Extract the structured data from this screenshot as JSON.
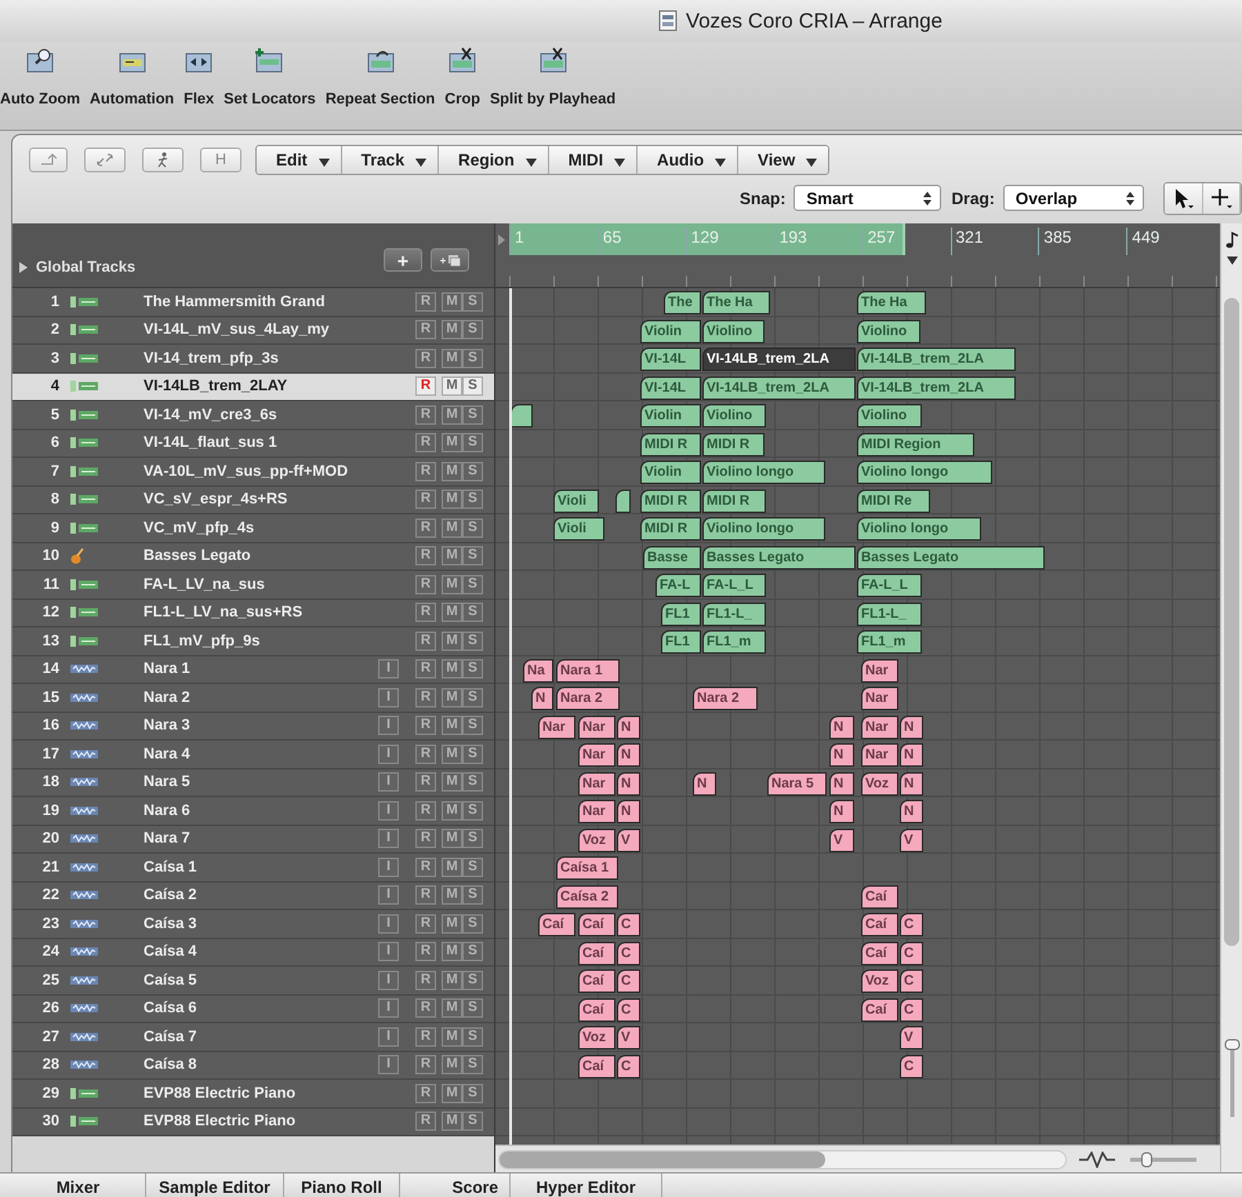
{
  "window": {
    "title": "Vozes Coro CRIA – Arrange"
  },
  "toolbar": [
    {
      "label": "Auto Zoom"
    },
    {
      "label": "Automation"
    },
    {
      "label": "Flex"
    },
    {
      "label": "Set Locators"
    },
    {
      "label": "Repeat Section"
    },
    {
      "label": "Crop"
    },
    {
      "label": "Split by Playhead"
    }
  ],
  "local_buttons": {
    "h": "H"
  },
  "menus": [
    "Edit",
    "Track",
    "Region",
    "MIDI",
    "Audio",
    "View"
  ],
  "snap": {
    "label": "Snap:",
    "value": "Smart"
  },
  "drag": {
    "label": "Drag:",
    "value": "Overlap"
  },
  "global_tracks": {
    "label": "Global Tracks",
    "expanded": false,
    "add": "+"
  },
  "ruler": {
    "marks": [
      "1",
      "65",
      "129",
      "193",
      "257",
      "321",
      "385",
      "449"
    ]
  },
  "tracks": [
    {
      "number": "1",
      "name": "The Hammersmith Grand",
      "kind": "software",
      "selected": false,
      "record": false,
      "buttons": [
        "R",
        "M",
        "S"
      ],
      "regions": [
        {
          "label": "The",
          "selected": false
        },
        {
          "label": "The Ha",
          "selected": false
        },
        {
          "label": "The Ha",
          "selected": false
        }
      ]
    },
    {
      "number": "2",
      "name": "VI-14L_mV_sus_4Lay_my",
      "kind": "software",
      "selected": false,
      "record": false,
      "buttons": [
        "R",
        "M",
        "S"
      ],
      "regions": [
        {
          "label": "Violin",
          "selected": false
        },
        {
          "label": "Violino",
          "selected": false
        },
        {
          "label": "Violino",
          "selected": false
        }
      ]
    },
    {
      "number": "3",
      "name": "VI-14_trem_pfp_3s",
      "kind": "software",
      "selected": false,
      "record": false,
      "buttons": [
        "R",
        "M",
        "S"
      ],
      "regions": [
        {
          "label": "VI-14L",
          "selected": false
        },
        {
          "label": "VI-14LB_trem_2LA",
          "selected": true
        },
        {
          "label": "VI-14LB_trem_2LA",
          "selected": false
        }
      ]
    },
    {
      "number": "4",
      "name": "VI-14LB_trem_2LAY",
      "kind": "software",
      "selected": true,
      "record": true,
      "buttons": [
        "R",
        "M",
        "S"
      ],
      "regions": [
        {
          "label": "VI-14L",
          "selected": false
        },
        {
          "label": "VI-14LB_trem_2LA",
          "selected": false
        },
        {
          "label": "VI-14LB_trem_2LA",
          "selected": false
        }
      ]
    },
    {
      "number": "5",
      "name": "VI-14_mV_cre3_6s",
      "kind": "software",
      "selected": false,
      "record": false,
      "buttons": [
        "R",
        "M",
        "S"
      ],
      "regions": [
        {
          "selected": false
        },
        {
          "label": "Violin",
          "selected": false
        },
        {
          "label": "Violino",
          "selected": false
        },
        {
          "label": "Violino",
          "selected": false
        }
      ]
    },
    {
      "number": "6",
      "name": "VI-14L_flaut_sus 1",
      "kind": "software",
      "selected": false,
      "record": false,
      "buttons": [
        "R",
        "M",
        "S"
      ],
      "regions": [
        {
          "label": "MIDI R",
          "selected": false
        },
        {
          "label": "MIDI R",
          "selected": false
        },
        {
          "label": "MIDI Region",
          "selected": false
        }
      ]
    },
    {
      "number": "7",
      "name": "VA-10L_mV_sus_pp-ff+MOD",
      "kind": "software",
      "selected": false,
      "record": false,
      "buttons": [
        "R",
        "M",
        "S"
      ],
      "regions": [
        {
          "label": "Violin",
          "selected": false
        },
        {
          "label": "Violino longo",
          "selected": false
        },
        {
          "label": "Violino longo",
          "selected": false
        }
      ]
    },
    {
      "number": "8",
      "name": "VC_sV_espr_4s+RS",
      "kind": "software",
      "selected": false,
      "record": false,
      "buttons": [
        "R",
        "M",
        "S"
      ],
      "regions": [
        {
          "label": "Violi",
          "selected": false
        },
        {
          "selected": false
        },
        {
          "label": "MIDI R",
          "selected": false
        },
        {
          "label": "MIDI R",
          "selected": false
        },
        {
          "label": "MIDI Re",
          "selected": false
        }
      ]
    },
    {
      "number": "9",
      "name": "VC_mV_pfp_4s",
      "kind": "software",
      "selected": false,
      "record": false,
      "buttons": [
        "R",
        "M",
        "S"
      ],
      "regions": [
        {
          "label": "Violi",
          "selected": false
        },
        {
          "label": "MIDI R",
          "selected": false
        },
        {
          "label": "Violino longo",
          "selected": false
        },
        {
          "label": "Violino longo",
          "selected": false
        }
      ]
    },
    {
      "number": "10",
      "name": "Basses Legato",
      "kind": "sampler",
      "selected": false,
      "record": false,
      "buttons": [
        "R",
        "M",
        "S"
      ],
      "regions": [
        {
          "label": "Basse",
          "selected": false
        },
        {
          "label": "Basses Legato",
          "selected": false
        },
        {
          "label": "Basses Legato",
          "selected": false
        }
      ]
    },
    {
      "number": "11",
      "name": "FA-L_LV_na_sus",
      "kind": "software",
      "selected": false,
      "record": false,
      "buttons": [
        "R",
        "M",
        "S"
      ],
      "regions": [
        {
          "label": "FA-L",
          "selected": false
        },
        {
          "label": "FA-L_L",
          "selected": false
        },
        {
          "label": "FA-L_L",
          "selected": false
        }
      ]
    },
    {
      "number": "12",
      "name": "FL1-L_LV_na_sus+RS",
      "kind": "software",
      "selected": false,
      "record": false,
      "buttons": [
        "R",
        "M",
        "S"
      ],
      "regions": [
        {
          "label": "FL1",
          "selected": false
        },
        {
          "label": "FL1-L_",
          "selected": false
        },
        {
          "label": "FL1-L_",
          "selected": false
        }
      ]
    },
    {
      "number": "13",
      "name": "FL1_mV_pfp_9s",
      "kind": "software",
      "selected": false,
      "record": false,
      "buttons": [
        "R",
        "M",
        "S"
      ],
      "regions": [
        {
          "label": "FL1",
          "selected": false
        },
        {
          "label": "FL1_m",
          "selected": false
        },
        {
          "label": "FL1_m",
          "selected": false
        }
      ]
    },
    {
      "number": "14",
      "name": "Nara 1",
      "kind": "audio",
      "selected": false,
      "record": false,
      "buttons": [
        "I",
        "R",
        "M",
        "S"
      ],
      "regions": [
        {
          "label": "Na",
          "selected": false
        },
        {
          "label": "Nara 1",
          "selected": false
        },
        {
          "label": "Nar",
          "selected": false
        }
      ]
    },
    {
      "number": "15",
      "name": "Nara 2",
      "kind": "audio",
      "selected": false,
      "record": false,
      "buttons": [
        "I",
        "R",
        "M",
        "S"
      ],
      "regions": [
        {
          "label": "N",
          "selected": false
        },
        {
          "label": "Nara 2",
          "selected": false
        },
        {
          "label": "Nara 2",
          "selected": false
        },
        {
          "label": "Nar",
          "selected": false
        }
      ]
    },
    {
      "number": "16",
      "name": "Nara 3",
      "kind": "audio",
      "selected": false,
      "record": false,
      "buttons": [
        "I",
        "R",
        "M",
        "S"
      ],
      "regions": [
        {
          "label": "Nar",
          "selected": false
        },
        {
          "label": "Nar",
          "selected": false
        },
        {
          "label": "N",
          "selected": false
        },
        {
          "label": "N",
          "selected": false
        },
        {
          "label": "Nar",
          "selected": false
        },
        {
          "label": "N",
          "selected": false
        }
      ]
    },
    {
      "number": "17",
      "name": "Nara 4",
      "kind": "audio",
      "selected": false,
      "record": false,
      "buttons": [
        "I",
        "R",
        "M",
        "S"
      ],
      "regions": [
        {
          "label": "Nar",
          "selected": false
        },
        {
          "label": "N",
          "selected": false
        },
        {
          "label": "N",
          "selected": false
        },
        {
          "label": "Nar",
          "selected": false
        },
        {
          "label": "N",
          "selected": false
        }
      ]
    },
    {
      "number": "18",
      "name": "Nara 5",
      "kind": "audio",
      "selected": false,
      "record": false,
      "buttons": [
        "I",
        "R",
        "M",
        "S"
      ],
      "regions": [
        {
          "label": "Nar",
          "selected": false
        },
        {
          "label": "N",
          "selected": false
        },
        {
          "label": "N",
          "selected": false
        },
        {
          "label": "Nara 5",
          "selected": false
        },
        {
          "label": "N",
          "selected": false
        },
        {
          "label": "Voz",
          "selected": false
        },
        {
          "label": "N",
          "selected": false
        }
      ]
    },
    {
      "number": "19",
      "name": "Nara 6",
      "kind": "audio",
      "selected": false,
      "record": false,
      "buttons": [
        "I",
        "R",
        "M",
        "S"
      ],
      "regions": [
        {
          "label": "Nar",
          "selected": false
        },
        {
          "label": "N",
          "selected": false
        },
        {
          "label": "N",
          "selected": false
        },
        {
          "label": "N",
          "selected": false
        }
      ]
    },
    {
      "number": "20",
      "name": "Nara 7",
      "kind": "audio",
      "selected": false,
      "record": false,
      "buttons": [
        "I",
        "R",
        "M",
        "S"
      ],
      "regions": [
        {
          "label": "Voz",
          "selected": false
        },
        {
          "label": "V",
          "selected": false
        },
        {
          "label": "V",
          "selected": false
        },
        {
          "label": "V",
          "selected": false
        }
      ]
    },
    {
      "number": "21",
      "name": "Caísa 1",
      "kind": "audio",
      "selected": false,
      "record": false,
      "buttons": [
        "I",
        "R",
        "M",
        "S"
      ],
      "regions": [
        {
          "label": "Caísa 1",
          "selected": false
        }
      ]
    },
    {
      "number": "22",
      "name": "Caísa 2",
      "kind": "audio",
      "selected": false,
      "record": false,
      "buttons": [
        "I",
        "R",
        "M",
        "S"
      ],
      "regions": [
        {
          "label": "Caísa 2",
          "selected": false
        },
        {
          "label": "Caí",
          "selected": false
        }
      ]
    },
    {
      "number": "23",
      "name": "Caísa 3",
      "kind": "audio",
      "selected": false,
      "record": false,
      "buttons": [
        "I",
        "R",
        "M",
        "S"
      ],
      "regions": [
        {
          "label": "Caí",
          "selected": false
        },
        {
          "label": "Caí",
          "selected": false
        },
        {
          "label": "C",
          "selected": false
        },
        {
          "label": "Caí",
          "selected": false
        },
        {
          "label": "C",
          "selected": false
        }
      ]
    },
    {
      "number": "24",
      "name": "Caísa 4",
      "kind": "audio",
      "selected": false,
      "record": false,
      "buttons": [
        "I",
        "R",
        "M",
        "S"
      ],
      "regions": [
        {
          "label": "Caí",
          "selected": false
        },
        {
          "label": "C",
          "selected": false
        },
        {
          "label": "Caí",
          "selected": false
        },
        {
          "label": "C",
          "selected": false
        }
      ]
    },
    {
      "number": "25",
      "name": "Caísa 5",
      "kind": "audio",
      "selected": false,
      "record": false,
      "buttons": [
        "I",
        "R",
        "M",
        "S"
      ],
      "regions": [
        {
          "label": "Caí",
          "selected": false
        },
        {
          "label": "C",
          "selected": false
        },
        {
          "label": "Voz",
          "selected": false
        },
        {
          "label": "C",
          "selected": false
        }
      ]
    },
    {
      "number": "26",
      "name": "Caísa 6",
      "kind": "audio",
      "selected": false,
      "record": false,
      "buttons": [
        "I",
        "R",
        "M",
        "S"
      ],
      "regions": [
        {
          "label": "Caí",
          "selected": false
        },
        {
          "label": "C",
          "selected": false
        },
        {
          "label": "Caí",
          "selected": false
        },
        {
          "label": "C",
          "selected": false
        }
      ]
    },
    {
      "number": "27",
      "name": "Caísa 7",
      "kind": "audio",
      "selected": false,
      "record": false,
      "buttons": [
        "I",
        "R",
        "M",
        "S"
      ],
      "regions": [
        {
          "label": "Voz",
          "selected": false
        },
        {
          "label": "V",
          "selected": false
        },
        {
          "label": "V",
          "selected": false
        }
      ]
    },
    {
      "number": "28",
      "name": "Caísa 8",
      "kind": "audio",
      "selected": false,
      "record": false,
      "buttons": [
        "I",
        "R",
        "M",
        "S"
      ],
      "regions": [
        {
          "label": "Caí",
          "selected": false
        },
        {
          "label": "C",
          "selected": false
        },
        {
          "label": "C",
          "selected": false
        }
      ]
    },
    {
      "number": "29",
      "name": "EVP88 Electric Piano",
      "kind": "software",
      "selected": false,
      "record": false,
      "buttons": [
        "R",
        "M",
        "S"
      ]
    },
    {
      "number": "30",
      "name": "EVP88 Electric Piano",
      "kind": "software",
      "selected": false,
      "record": false,
      "buttons": [
        "R",
        "M",
        "S"
      ]
    }
  ],
  "zoom": {
    "horizontal": {
      "level": 0.22
    }
  },
  "bottom_tabs": [
    "Mixer",
    "Sample Editor",
    "Piano Roll",
    "Score",
    "Hyper Editor"
  ]
}
